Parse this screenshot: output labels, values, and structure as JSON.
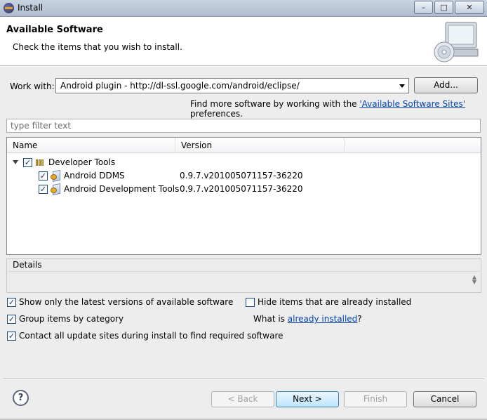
{
  "window": {
    "title": "Install",
    "buttons": {
      "minimize": "–",
      "maximize": "□",
      "close": "✕"
    }
  },
  "header": {
    "title": "Available Software",
    "subtitle": "Check the items that you wish to install."
  },
  "work_with": {
    "label": "Work with:",
    "value": "Android plugin - http://dl-ssl.google.com/android/eclipse/",
    "add_button": "Add...",
    "hint_prefix": "Find more software by working with the ",
    "hint_link": "'Available Software Sites'",
    "hint_suffix": " preferences."
  },
  "filter": {
    "placeholder": "type filter text"
  },
  "tree": {
    "columns": [
      "Name",
      "Version"
    ],
    "category": {
      "name": "Developer Tools",
      "checked": true
    },
    "items": [
      {
        "name": "Android DDMS",
        "version": "0.9.7.v201005071157-36220",
        "checked": true
      },
      {
        "name": "Android Development Tools",
        "version": "0.9.7.v201005071157-36220",
        "checked": true
      }
    ]
  },
  "details": {
    "label": "Details"
  },
  "options": {
    "show_latest": {
      "label": "Show only the latest versions of available software",
      "checked": true
    },
    "hide_installed": {
      "label": "Hide items that are already installed",
      "checked": false
    },
    "group_by_category": {
      "label": "Group items by category",
      "checked": true
    },
    "what_is_prefix": "What is ",
    "what_is_link": "already installed",
    "what_is_suffix": "?",
    "contact_sites": {
      "label": "Contact all update sites during install to find required software",
      "checked": true
    }
  },
  "footer": {
    "help": "?",
    "back": "< Back",
    "next": "Next >",
    "finish": "Finish",
    "cancel": "Cancel"
  },
  "colors": {
    "link": "#0645ad",
    "dialog_bg": "#ededed",
    "titlebar": "#aebcce"
  },
  "icons": [
    "eclipse-icon",
    "install-banner-icon",
    "category-icon",
    "feature-icon",
    "help-icon",
    "dropdown-arrow-icon",
    "expander-icon"
  ]
}
